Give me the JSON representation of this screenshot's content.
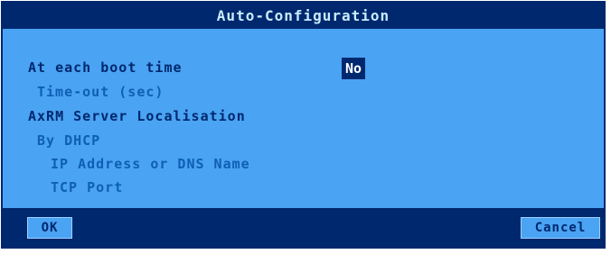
{
  "dialog": {
    "title": "Auto-Configuration",
    "boot": {
      "label": "At each boot time",
      "value": "No"
    },
    "timeout_label": "Time-out (sec)",
    "server_label": "AxRM Server Localisation",
    "dhcp_label": "By DHCP",
    "ip_label": "IP Address or DNS Name",
    "tcp_label": "TCP Port"
  },
  "buttons": {
    "ok": "OK",
    "cancel": "Cancel"
  },
  "colors": {
    "title_bg": "#00286e",
    "dialog_bg": "#4aa3f3",
    "active_text": "#00286e",
    "inactive_text": "#0f5fb4",
    "title_text": "#c8ecff"
  }
}
